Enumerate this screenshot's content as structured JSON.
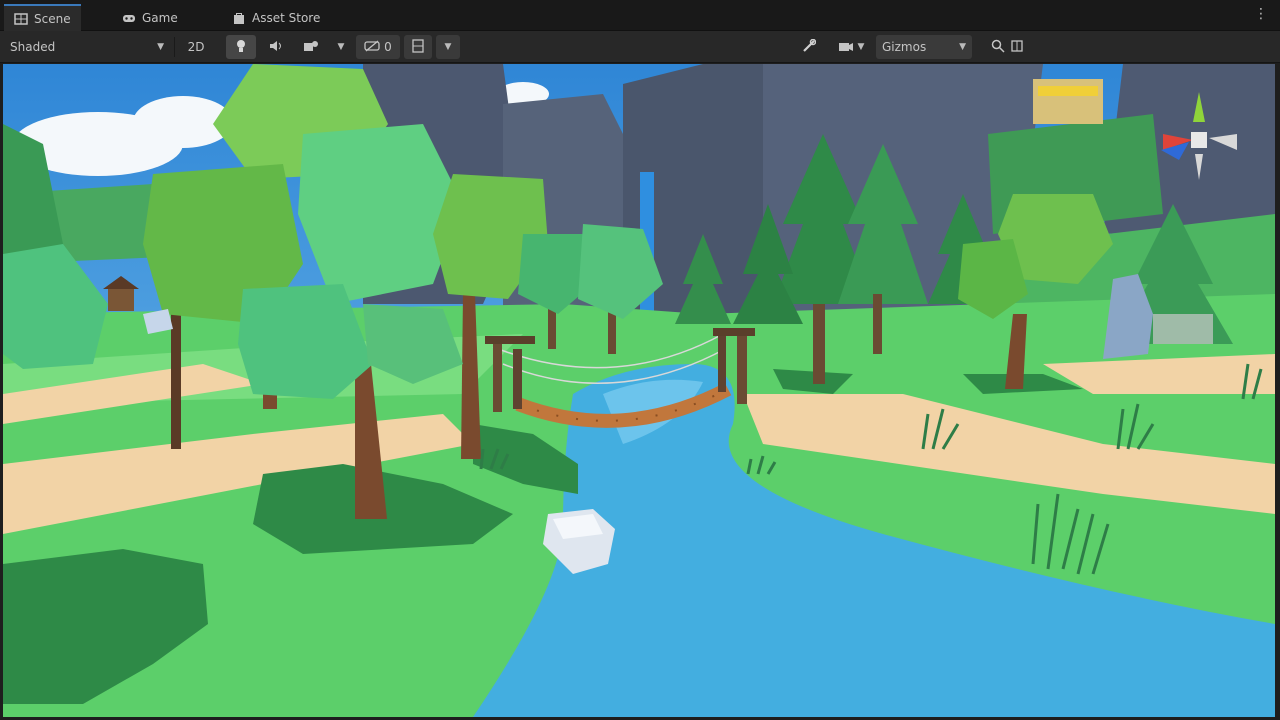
{
  "tabs": [
    {
      "label": "Scene",
      "icon": "grid-icon",
      "active": true
    },
    {
      "label": "Game",
      "icon": "gamepad-icon",
      "active": false
    },
    {
      "label": "Asset Store",
      "icon": "bag-icon",
      "active": false
    }
  ],
  "toolbar": {
    "draw_mode": "Shaded",
    "mode_2d": "2D",
    "gizmos_label": "Gizmos",
    "counter": "0"
  },
  "colors": {
    "accent": "#3a79bb",
    "sky": "#4aa0de",
    "grass": "#5cd86c",
    "water": "#43aee0",
    "path": "#f2d3a6"
  }
}
